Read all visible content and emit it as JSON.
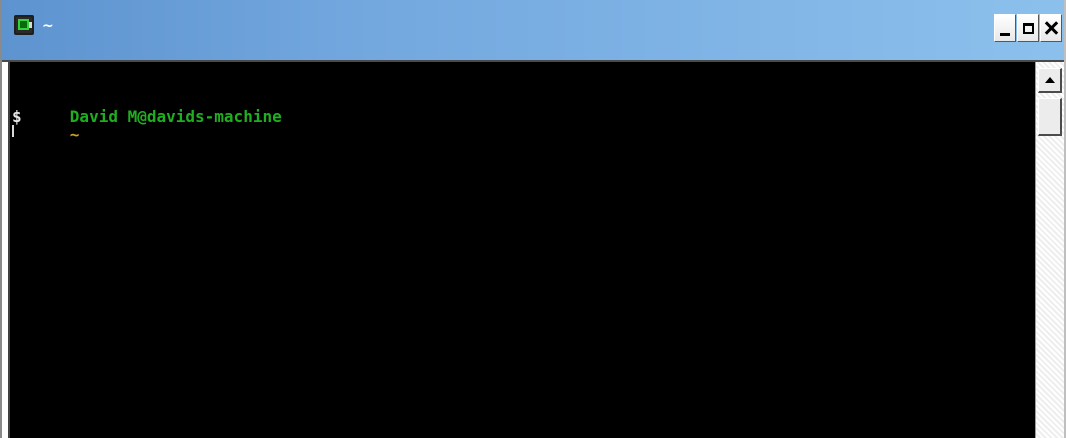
{
  "window": {
    "title": "~",
    "icon": "terminal-icon"
  },
  "titlebar_buttons": {
    "minimize": "minimize",
    "maximize": "maximize",
    "close": "close"
  },
  "terminal": {
    "prompt_user_host": "David M@davids-machine",
    "prompt_cwd": "~",
    "prompt_symbol": "$"
  },
  "colors": {
    "titlebar_start": "#5d93cf",
    "titlebar_end": "#8cc0ec",
    "console_background": "#000000",
    "prompt_user_host": "#1fae1f",
    "prompt_cwd": "#c8a12a",
    "prompt_symbol": "#e8e8e8"
  },
  "scrollbar": {
    "position": 0
  }
}
